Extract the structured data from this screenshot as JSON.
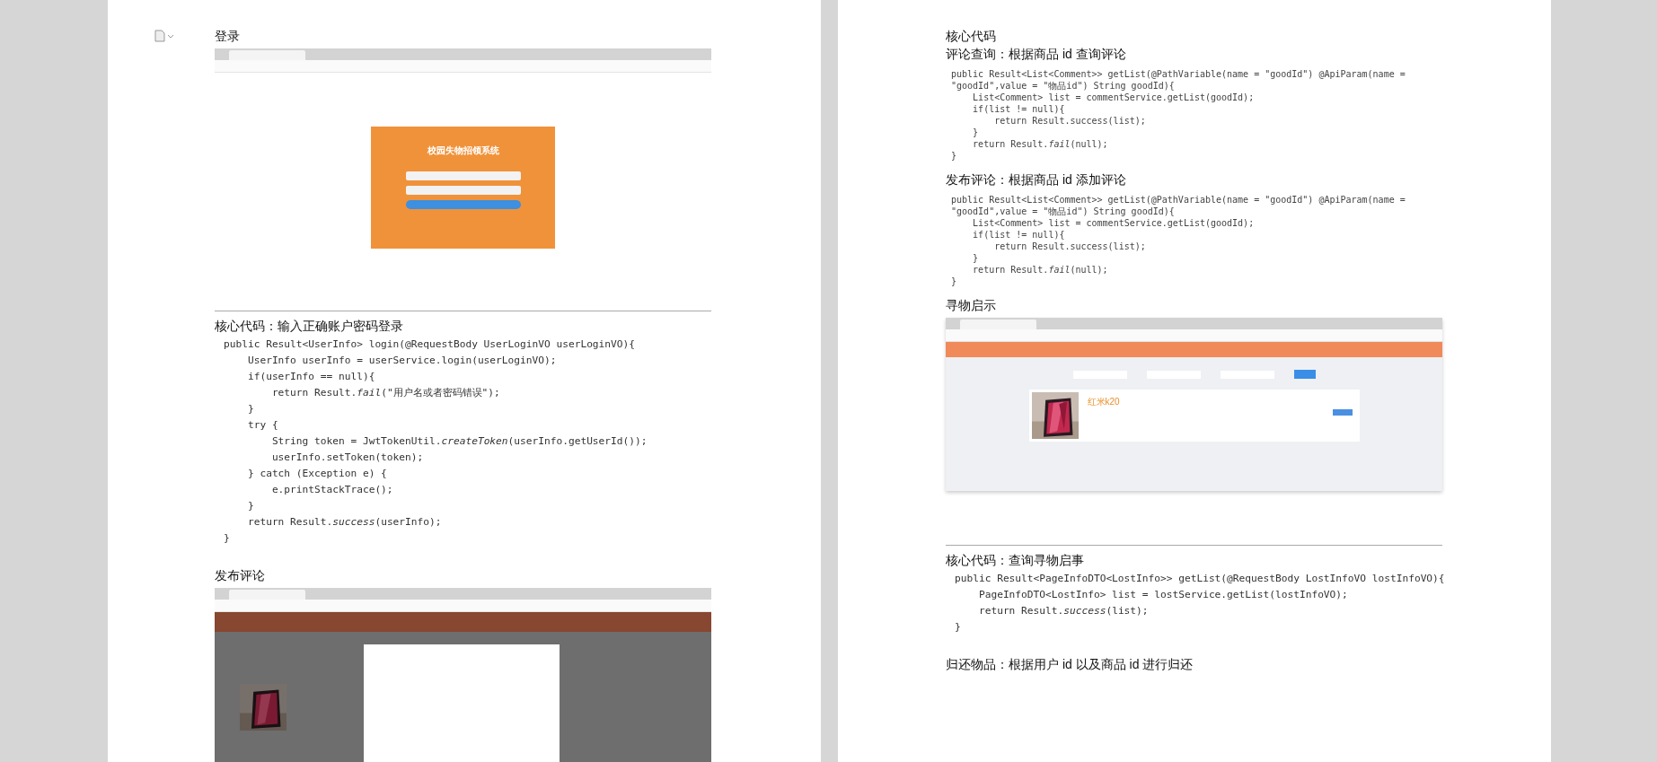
{
  "pages": [
    {
      "blocks": [
        {
          "kind": "heading",
          "text": "登录"
        },
        {
          "kind": "login_screenshot",
          "title": "校园失物招领系统"
        },
        {
          "kind": "rule"
        },
        {
          "kind": "heading",
          "text": "核心代码：输入正确账户密码登录"
        },
        {
          "kind": "code",
          "lines": [
            "public Result<UserInfo> login(@RequestBody UserLoginVO userLoginVO){",
            "    UserInfo userInfo = userService.login(userLoginVO);",
            "    if(userInfo == null){",
            "        return Result.*fail*(\"用户名或者密码错误\");",
            "    }",
            "    try {",
            "        String token = JwtTokenUtil.*createToken*(userInfo.getUserId());",
            "        userInfo.setToken(token);",
            "    } catch (Exception e) {",
            "        e.printStackTrace();",
            "    }",
            "    return Result.*success*(userInfo);",
            "}"
          ]
        },
        {
          "kind": "heading",
          "text": "发布评论"
        },
        {
          "kind": "dialog_screenshot"
        }
      ]
    },
    {
      "blocks": [
        {
          "kind": "heading",
          "text": "核心代码"
        },
        {
          "kind": "heading",
          "text": "评论查询：根据商品 id 查询评论"
        },
        {
          "kind": "code_small",
          "lines": [
            "public Result<List<Comment>> getList(@PathVariable(name = \"goodId\") @ApiParam(name = \"goodId\",value = \"物品id\") String goodId){",
            "    List<Comment> list = commentService.getList(goodId);",
            "    if(list != null){",
            "        return Result.success(list);",
            "    }",
            "    return Result.*fail*(null);",
            "}"
          ]
        },
        {
          "kind": "heading",
          "text": "发布评论：根据商品 id 添加评论"
        },
        {
          "kind": "code_small",
          "lines": [
            "public Result<List<Comment>> getList(@PathVariable(name = \"goodId\") @ApiParam(name = \"goodId\",value = \"物品id\") String goodId){",
            "    List<Comment> list = commentService.getList(goodId);",
            "    if(list != null){",
            "        return Result.success(list);",
            "    }",
            "    return Result.*fail*(null);",
            "}"
          ]
        },
        {
          "kind": "heading",
          "text": "寻物启示"
        },
        {
          "kind": "list_screenshot",
          "item_title": "红米k20"
        },
        {
          "kind": "rule"
        },
        {
          "kind": "heading",
          "text": "核心代码：查询寻物启事"
        },
        {
          "kind": "code",
          "lines": [
            "public Result<PageInfoDTO<LostInfo>> getList(@RequestBody LostInfoVO lostInfoVO){",
            "    PageInfoDTO<LostInfo> list = lostService.getList(lostInfoVO);",
            "    return Result.*success*(list);",
            "}"
          ]
        },
        {
          "kind": "heading",
          "text": "归还物品：根据用户 id 以及商品 id 进行归还"
        }
      ]
    }
  ]
}
